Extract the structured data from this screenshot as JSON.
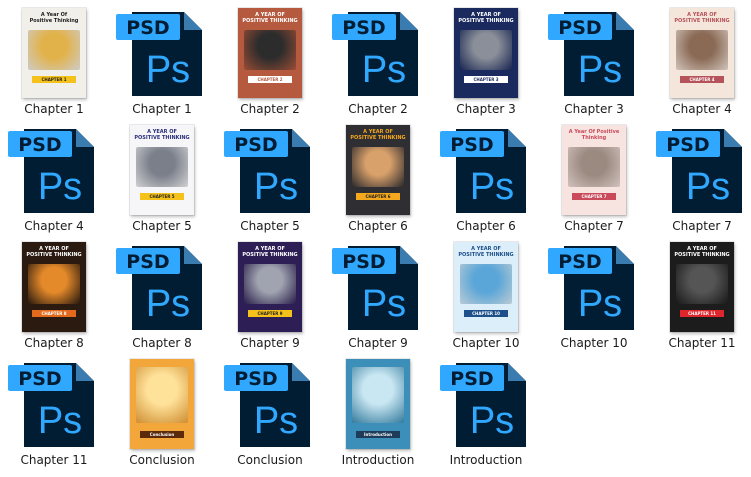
{
  "items": [
    {
      "label": "Chapter 1",
      "type": "cover",
      "cover": {
        "bg": "#f1efe9",
        "top": "A Year Of\nPositive Thinking",
        "tag": "CHAPTER 1",
        "textColor": "#1d1d1d",
        "tagBg": "#f4c21b",
        "tagColor": "#1d1d1d",
        "pic": "#e2b24a"
      }
    },
    {
      "label": "Chapter 1",
      "type": "psd"
    },
    {
      "label": "Chapter 2",
      "type": "cover",
      "cover": {
        "bg": "#b55a3e",
        "top": "A YEAR OF\nPOSITIVE THINKING",
        "tag": "CHAPTER 2",
        "textColor": "#ffffff",
        "tagBg": "#ffffff",
        "tagColor": "#b55a3e",
        "pic": "#2c2c2c"
      }
    },
    {
      "label": "Chapter 2",
      "type": "psd"
    },
    {
      "label": "Chapter 3",
      "type": "cover",
      "cover": {
        "bg": "#1b2a5e",
        "top": "A YEAR OF\nPOSITIVE THINKING",
        "tag": "CHAPTER 3",
        "textColor": "#ffffff",
        "tagBg": "#ffffff",
        "tagColor": "#1b2a5e",
        "pic": "#8a8f99"
      }
    },
    {
      "label": "Chapter 3",
      "type": "psd"
    },
    {
      "label": "Chapter 4",
      "type": "cover",
      "cover": {
        "bg": "#f5e6dc",
        "top": "A YEAR OF\nPOSITIVE THINKING",
        "tag": "CHAPTER 4",
        "textColor": "#b5525a",
        "tagBg": "#b5525a",
        "tagColor": "#ffffff",
        "pic": "#8a6a55"
      }
    },
    {
      "label": "Chapter 4",
      "type": "psd"
    },
    {
      "label": "Chapter 5",
      "type": "cover",
      "cover": {
        "bg": "#f6f6f8",
        "top": "A YEAR OF\nPOSITIVE THINKING",
        "tag": "CHAPTER 5",
        "textColor": "#2a2f7a",
        "tagBg": "#f4c21b",
        "tagColor": "#1d1d1d",
        "pic": "#7a7f8a"
      }
    },
    {
      "label": "Chapter 5",
      "type": "psd"
    },
    {
      "label": "Chapter 6",
      "type": "cover",
      "cover": {
        "bg": "#2e2e33",
        "top": "A YEAR OF\nPOSITIVE THINKING",
        "tag": "CHAPTER 6",
        "textColor": "#f4a81d",
        "tagBg": "#f4a81d",
        "tagColor": "#1d1d1d",
        "pic": "#d8a06a"
      }
    },
    {
      "label": "Chapter 6",
      "type": "psd"
    },
    {
      "label": "Chapter 7",
      "type": "cover",
      "cover": {
        "bg": "#f7e4e0",
        "top": "A Year Of Positive Thinking",
        "tag": "CHAPTER 7",
        "textColor": "#c94a5a",
        "tagBg": "#c94a5a",
        "tagColor": "#ffffff",
        "pic": "#9a8a80"
      }
    },
    {
      "label": "Chapter 7",
      "type": "psd"
    },
    {
      "label": "Chapter 8",
      "type": "cover",
      "cover": {
        "bg": "#2a1a10",
        "top": "A YEAR OF\nPOSITIVE THINKING",
        "tag": "CHAPTER 8",
        "textColor": "#ffffff",
        "tagBg": "#e36a1c",
        "tagColor": "#ffffff",
        "pic": "#e58a2a"
      }
    },
    {
      "label": "Chapter 8",
      "type": "psd"
    },
    {
      "label": "Chapter 9",
      "type": "cover",
      "cover": {
        "bg": "#2d1f55",
        "top": "A YEAR OF\nPOSITIVE THINKING",
        "tag": "CHAPTER 9",
        "textColor": "#ffffff",
        "tagBg": "#f4c21b",
        "tagColor": "#1d1d1d",
        "pic": "#a0a4b0"
      }
    },
    {
      "label": "Chapter 9",
      "type": "psd"
    },
    {
      "label": "Chapter 10",
      "type": "cover",
      "cover": {
        "bg": "#dbeef9",
        "top": "A YEAR OF\nPOSITIVE THINKING",
        "tag": "CHAPTER 10",
        "textColor": "#1d4f8a",
        "tagBg": "#1d4f8a",
        "tagColor": "#ffffff",
        "pic": "#5aa6d8"
      }
    },
    {
      "label": "Chapter 10",
      "type": "psd"
    },
    {
      "label": "Chapter 11",
      "type": "cover",
      "cover": {
        "bg": "#1c1c1c",
        "top": "A YEAR OF\nPOSITIVE THINKING",
        "tag": "CHAPTER 11",
        "textColor": "#ffffff",
        "tagBg": "#e0262d",
        "tagColor": "#ffffff",
        "pic": "#555555"
      }
    },
    {
      "label": "Chapter 11",
      "type": "psd"
    },
    {
      "label": "Conclusion",
      "type": "cover",
      "cover": {
        "bg": "#f3a63a",
        "top": "",
        "tag": "Conclusion",
        "textColor": "#4a2a0a",
        "tagBg": "#5a2a0a",
        "tagColor": "#ffffff",
        "pic": "#ffe29a"
      }
    },
    {
      "label": "Conclusion",
      "type": "psd"
    },
    {
      "label": "Introduction",
      "type": "cover",
      "cover": {
        "bg": "#3b8fb8",
        "top": "",
        "tag": "Introduction",
        "textColor": "#ffffff",
        "tagBg": "#1e3c5a",
        "tagColor": "#ffffff",
        "pic": "#c9e7f2"
      }
    },
    {
      "label": "Introduction",
      "type": "psd"
    }
  ],
  "psd_icon": {
    "text": "PSD",
    "glyph": "Ps",
    "fill": "#001d34",
    "fold": "#3a7bb0",
    "tab": "#31a8ff",
    "glyphColor": "#31a8ff"
  }
}
